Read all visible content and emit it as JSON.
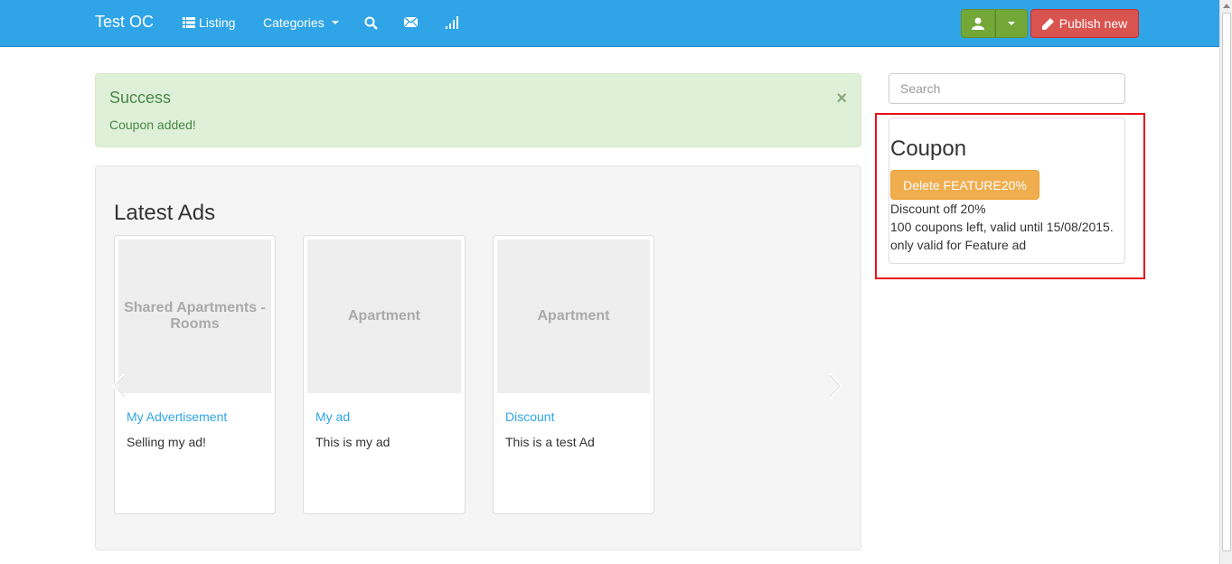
{
  "navbar": {
    "brand": "Test OC",
    "listing": "Listing",
    "categories": "Categories",
    "publish": "Publish new",
    "icons": [
      "list-icon",
      "search-icon",
      "envelope-icon",
      "signal-icon",
      "user-icon",
      "pencil-icon"
    ]
  },
  "alert": {
    "title": "Success",
    "text": "Coupon added!",
    "close": "×"
  },
  "latest": {
    "title": "Latest Ads",
    "ads": [
      {
        "image_text": "Shared Apartments - Rooms",
        "title": "My Advertisement",
        "description": "Selling my ad!"
      },
      {
        "image_text": "Apartment",
        "title": "My ad",
        "description": "This is my ad"
      },
      {
        "image_text": "Apartment",
        "title": "Discount",
        "description": "This is a test Ad"
      }
    ]
  },
  "sidebar": {
    "search_placeholder": "Search",
    "coupon": {
      "title": "Coupon",
      "delete_label": "Delete FEATURE20%",
      "discount": "Discount off 20%",
      "validity": "100 coupons left, valid until 15/08/2015.",
      "restriction": "only valid for Feature ad"
    }
  },
  "colors": {
    "navbar": "#2fa4e7",
    "success_bg": "#dff0d8",
    "publish": "#d9534f",
    "user": "#73a839",
    "coupon_button": "#f0ad4e",
    "highlight": "#e8101a"
  }
}
